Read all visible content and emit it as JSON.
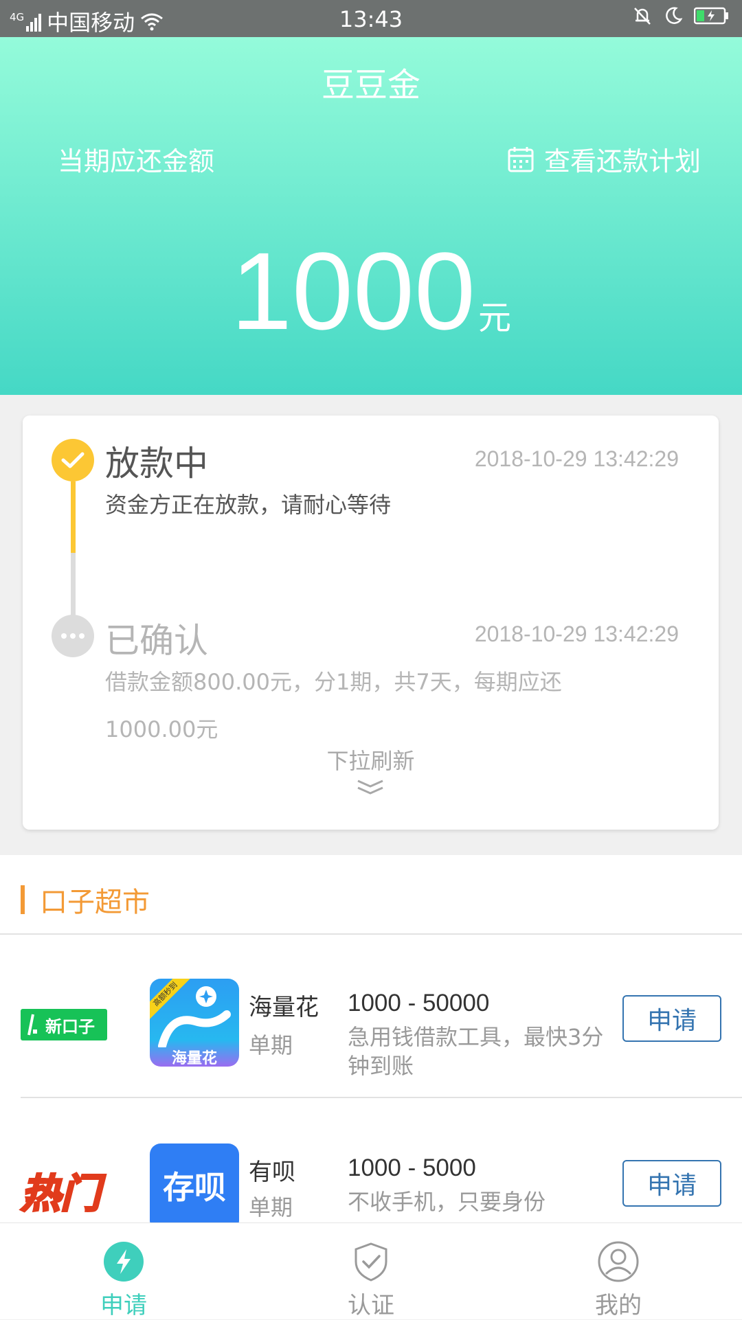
{
  "status_bar": {
    "network": "4G",
    "carrier": "中国移动",
    "time": "13:43"
  },
  "header": {
    "title": "豆豆金",
    "due_label": "当期应还金额",
    "plan_link": "查看还款计划",
    "amount": "1000",
    "amount_unit": "元"
  },
  "status_card": {
    "steps": [
      {
        "title": "放款中",
        "time": "2018-10-29 13:42:29",
        "desc": "资金方正在放款，请耐心等待"
      },
      {
        "title": "已确认",
        "time": "2018-10-29 13:42:29",
        "desc_line1": "借款金额800.00元，分1期，共7天，每期应还",
        "desc_line2": "1000.00元"
      }
    ],
    "refresh_hint": "下拉刷新"
  },
  "market": {
    "title": "口子超市",
    "products": [
      {
        "tag": "新口子",
        "logo_text": "海量花",
        "logo_badge": "高额秒到",
        "name": "海量花",
        "term": "单期",
        "range": "1000 - 50000",
        "desc": "急用钱借款工具，最快3分钟到账",
        "button": "申请"
      },
      {
        "tag": "热门",
        "logo_text": "存呗",
        "name": "有呗",
        "term": "单期",
        "range": "1000 - 5000",
        "desc": "不收手机，只要身份",
        "button": "申请"
      }
    ]
  },
  "bottom_nav": {
    "items": [
      {
        "label": "申请",
        "icon": "lightning-icon",
        "active": true
      },
      {
        "label": "认证",
        "icon": "shield-check-icon",
        "active": false
      },
      {
        "label": "我的",
        "icon": "user-icon",
        "active": false
      }
    ]
  },
  "colors": {
    "header_top": "#94fbda",
    "header_bottom": "#45d8c5",
    "active_step": "#fcc734",
    "market_accent": "#f39a36",
    "apply_button": "#3474b0",
    "nav_active": "#3fcfbc"
  }
}
